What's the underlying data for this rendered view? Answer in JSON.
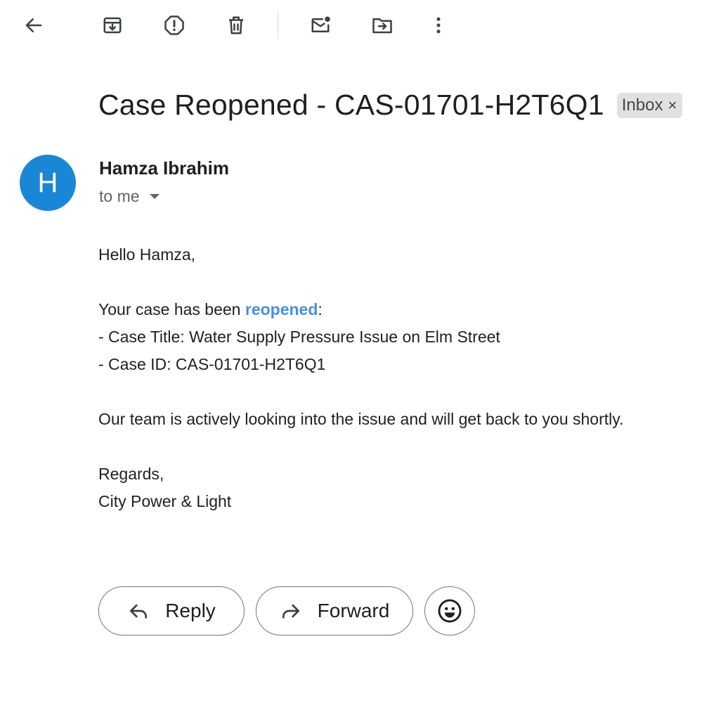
{
  "toolbar": {
    "icons": [
      "back-icon",
      "archive-icon",
      "report-spam-icon",
      "delete-icon",
      "mark-unread-icon",
      "move-to-icon",
      "more-options-icon"
    ]
  },
  "email": {
    "subject": "Case Reopened - CAS-01701-H2T6Q1",
    "label_chip": "Inbox",
    "label_close": "×",
    "sender_initial": "H",
    "sender_name": "Hamza Ibrahim",
    "recipient_text": "to me",
    "body": {
      "greeting": "Hello Hamza,",
      "intro_prefix": "Your case has been ",
      "intro_highlight": "reopened",
      "intro_suffix": ":",
      "case_title_line": "- Case Title: Water Supply Pressure Issue on Elm Street",
      "case_id_line": "- Case ID: CAS-01701-H2T6Q1",
      "status_line": "Our team is actively looking into the issue and will get back to you shortly.",
      "signoff": "Regards,",
      "signature": "City Power & Light"
    }
  },
  "actions": {
    "reply_label": "Reply",
    "forward_label": "Forward"
  },
  "colors": {
    "avatar": "#1a87d6",
    "highlight": "#4a90d9",
    "chip_bg": "#e1e1e1"
  }
}
